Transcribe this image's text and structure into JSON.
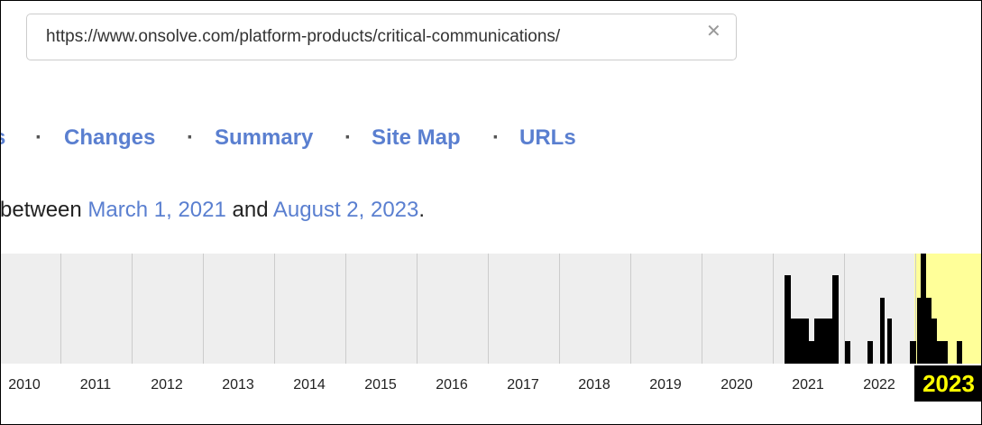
{
  "urlbar": {
    "value": "https://www.onsolve.com/platform-products/critical-communications/",
    "clear_icon": "close-icon"
  },
  "nav": {
    "separator": "·",
    "cut_label": "s",
    "items": [
      "Changes",
      "Summary",
      "Site Map",
      "URLs"
    ]
  },
  "range": {
    "prefix": "between",
    "start": "March 1, 2021",
    "middle": "and",
    "end": "August 2, 2023",
    "suffix": "."
  },
  "timeline": {
    "years": [
      "2010",
      "2011",
      "2012",
      "2013",
      "2014",
      "2015",
      "2016",
      "2017",
      "2018",
      "2019",
      "2020",
      "2021",
      "2022"
    ],
    "current_year": "2023",
    "colors": {
      "background": "#eeeeee",
      "highlight": "#ffff99",
      "bars": "#000000",
      "gridline": "#cccccc"
    }
  }
}
